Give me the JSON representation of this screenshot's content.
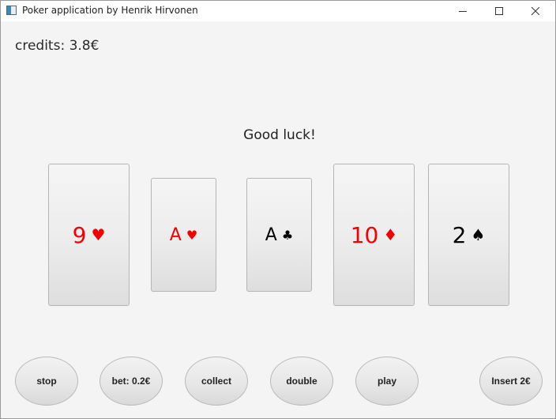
{
  "window": {
    "title": "Poker application by Henrik Hirvonen",
    "minimize_glyph": "—",
    "maximize_glyph": "☐",
    "close_glyph": "✕"
  },
  "credits_text": "credits: 3.8€",
  "status_text": "Good luck!",
  "cards": [
    {
      "rank": "9",
      "suit": "♥",
      "color": "#f40000"
    },
    {
      "rank": "A",
      "suit": "♥",
      "color": "#f40000"
    },
    {
      "rank": "A",
      "suit": "♣",
      "color": "#000000"
    },
    {
      "rank": "10",
      "suit": "♦",
      "color": "#f40000"
    },
    {
      "rank": "2",
      "suit": "♠",
      "color": "#000000"
    }
  ],
  "buttons": {
    "stop": "stop",
    "bet": "bet: 0.2€",
    "collect": "collect",
    "double": "double",
    "play": "play",
    "insert": "Insert 2€"
  }
}
